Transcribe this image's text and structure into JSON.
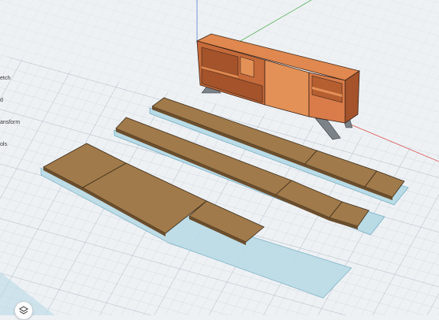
{
  "tool_menu": {
    "items": [
      {
        "label": "etch"
      },
      {
        "label": "d"
      },
      {
        "label": "ansform"
      },
      {
        "label": "ols"
      }
    ]
  },
  "layers_button": {
    "icon": "layers-icon"
  },
  "colors": {
    "canvas_background": "#eef1f4",
    "grid_line": "#c9d3dc",
    "plywood_panel": "#a07a4a",
    "panel_footprint": "#b9dbe6",
    "cabinet_body": "#d97c4a",
    "cabinet_front": "#e39157",
    "steel_leg": "#7b8288",
    "axis_green": "#5bb15a",
    "axis_red": "#d9534f",
    "axis_blue": "#5a7fd1"
  }
}
